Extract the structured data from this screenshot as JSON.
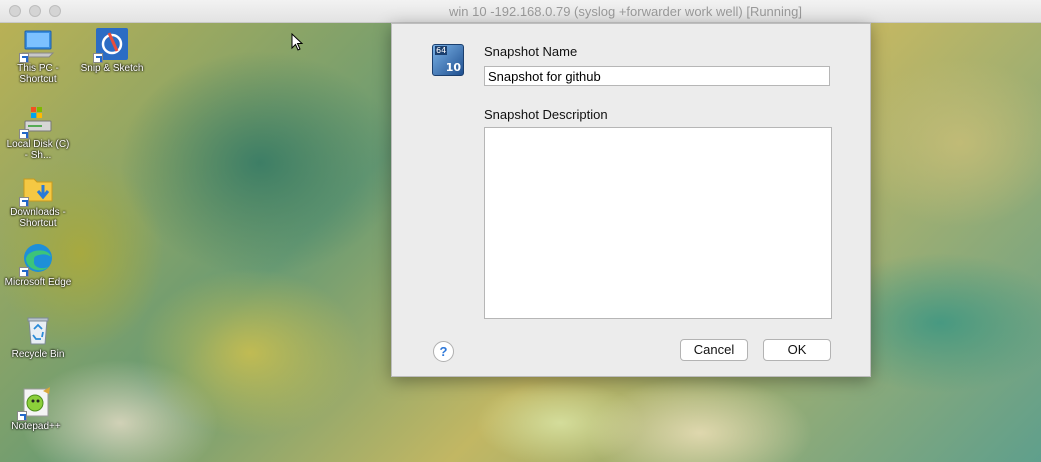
{
  "window": {
    "title": "win 10 -192.168.0.79  (syslog +forwarder work well) [Running]"
  },
  "desktop_icons": [
    {
      "label": "This PC - Shortcut",
      "icon": "computer-icon"
    },
    {
      "label": "Snip & Sketch",
      "icon": "snip-sketch-icon"
    },
    {
      "label": "Local Disk (C) - Sh...",
      "icon": "drive-icon"
    },
    {
      "label": "Downloads - Shortcut",
      "icon": "downloads-folder-icon"
    },
    {
      "label": "Microsoft Edge",
      "icon": "edge-icon"
    },
    {
      "label": "Recycle Bin",
      "icon": "recycle-bin-icon"
    },
    {
      "label": "Notepad++",
      "icon": "notepad-plus-plus-icon"
    }
  ],
  "dialog": {
    "icon_badge_top": "64",
    "icon_badge_bottom": "10",
    "name_label": "Snapshot Name",
    "name_value": "Snapshot for github",
    "description_label": "Snapshot Description",
    "description_value": "",
    "help_label": "?",
    "cancel_label": "Cancel",
    "ok_label": "OK"
  }
}
